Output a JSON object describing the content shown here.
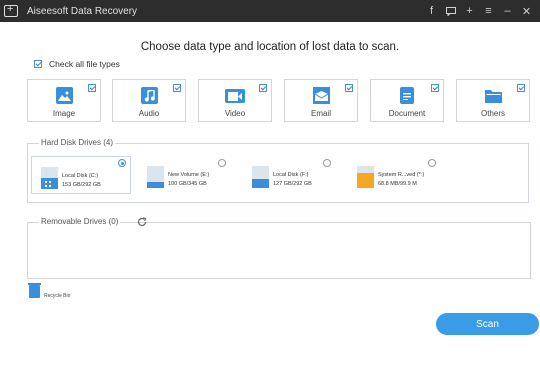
{
  "window": {
    "title": "Aiseesoft Data Recovery"
  },
  "titlebar_controls": [
    "facebook-icon",
    "feedback-icon",
    "plus-icon",
    "menu-icon",
    "minimize-icon",
    "close-icon"
  ],
  "headline": "Choose data type and location of lost data to scan.",
  "check_all": {
    "label": "Check all file types",
    "checked": true
  },
  "file_types": [
    {
      "label": "Image",
      "icon": "image-icon",
      "checked": true
    },
    {
      "label": "Audio",
      "icon": "audio-icon",
      "checked": true
    },
    {
      "label": "Video",
      "icon": "video-icon",
      "checked": true
    },
    {
      "label": "Email",
      "icon": "email-icon",
      "checked": true
    },
    {
      "label": "Document",
      "icon": "document-icon",
      "checked": true
    },
    {
      "label": "Others",
      "icon": "folder-icon",
      "checked": true
    }
  ],
  "hard_disk": {
    "title": "Hard Disk Drives (4)",
    "drives": [
      {
        "name": "Local Disk (C:)",
        "size": "153 GB/292 GB",
        "selected": true,
        "used_fraction": 0.52,
        "color": "#3a8fdc",
        "system": true
      },
      {
        "name": "New Volume (E:)",
        "size": "100 GB/345 GB",
        "selected": false,
        "used_fraction": 0.29,
        "color": "#3a8fdc",
        "system": false
      },
      {
        "name": "Local Disk (F:)",
        "size": "127 GB/292 GB",
        "selected": false,
        "used_fraction": 0.43,
        "color": "#3a8fdc",
        "system": false
      },
      {
        "name": "System R...ved (*:)",
        "size": "68.8 MB/99.9 M",
        "selected": false,
        "used_fraction": 0.69,
        "color": "#f5a623",
        "system": false
      }
    ]
  },
  "removable": {
    "title": "Removable Drives (0)"
  },
  "recycle_bin": {
    "label": "Recycle Bin"
  },
  "scan_button": {
    "label": "Scan"
  },
  "colors": {
    "accent": "#3a8fdc",
    "titlebar": "#2d2d2d",
    "scan": "#3a9be6"
  }
}
